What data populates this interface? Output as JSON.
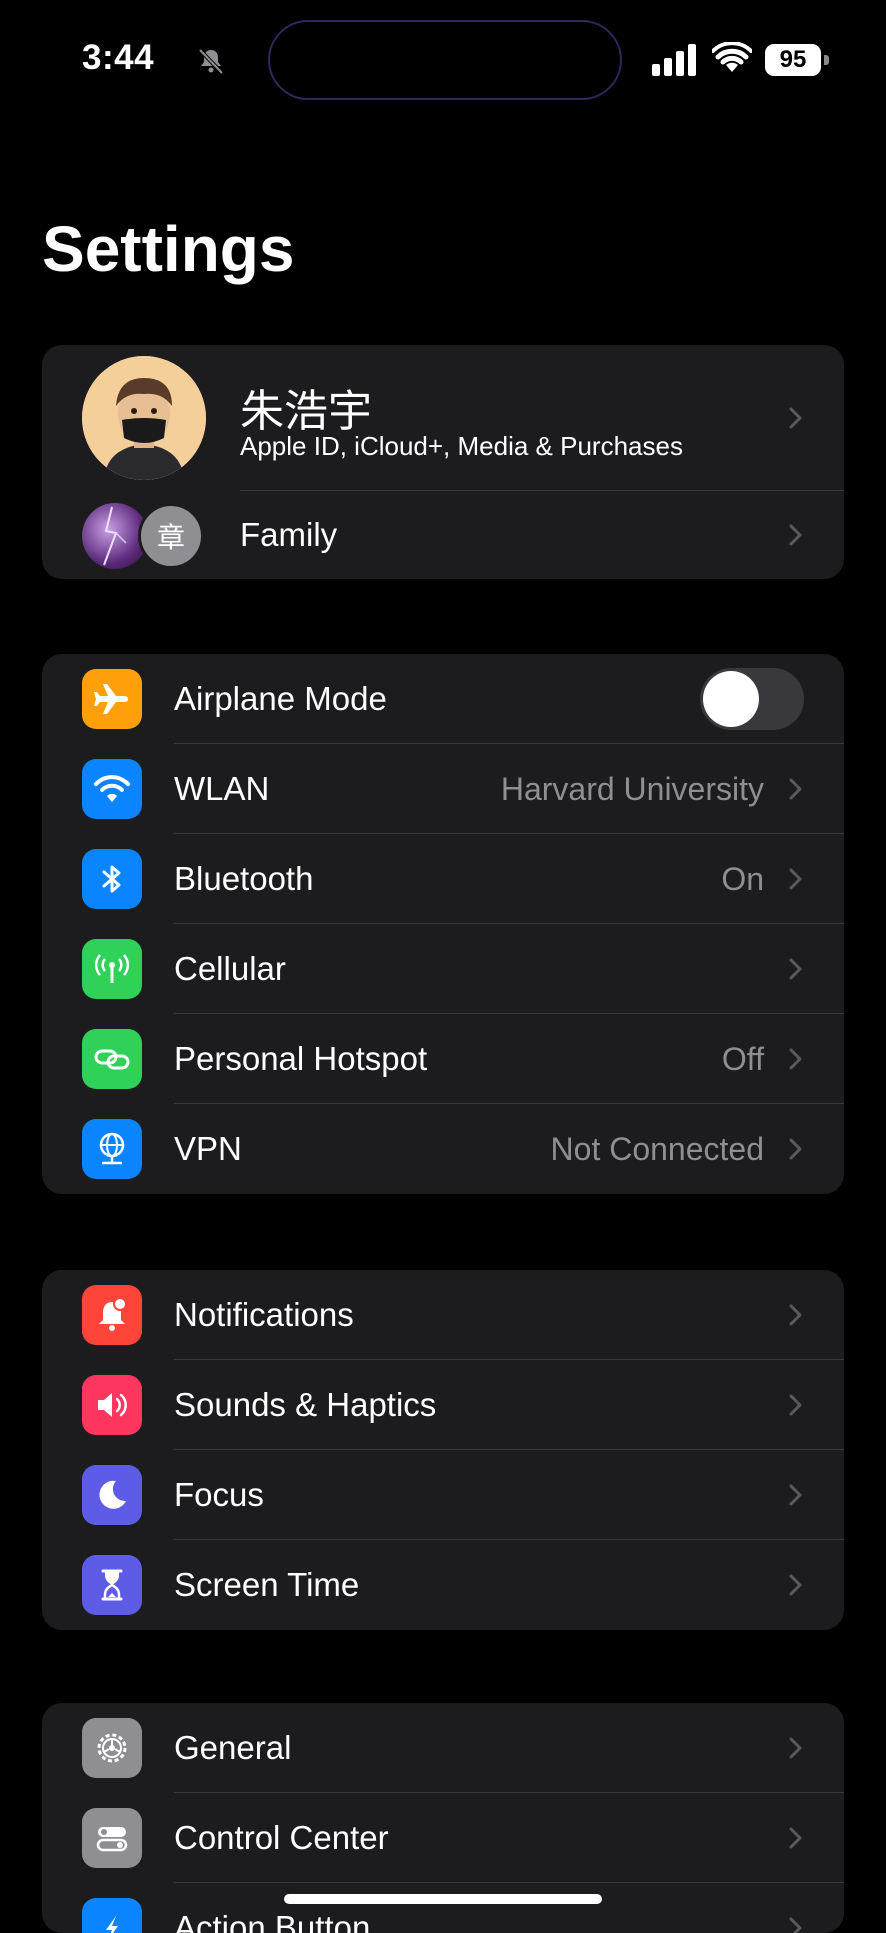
{
  "status_bar": {
    "time": "3:44",
    "battery": "95",
    "icons": [
      "bell-slash-icon",
      "cellular-signal-icon",
      "wifi-icon",
      "battery-icon"
    ]
  },
  "page": {
    "title": "Settings"
  },
  "profile": {
    "name": "朱浩宇",
    "subtitle": "Apple ID, iCloud+, Media & Purchases",
    "family_label": "Family",
    "family_member_initial": "章"
  },
  "connectivity": {
    "airplane": {
      "label": "Airplane Mode",
      "icon": "airplane-icon",
      "color": "#ff9f0a",
      "on": false
    },
    "wlan": {
      "label": "WLAN",
      "value": "Harvard University",
      "icon": "wifi-icon",
      "color": "#0a84ff"
    },
    "bluetooth": {
      "label": "Bluetooth",
      "value": "On",
      "icon": "bluetooth-icon",
      "color": "#0a84ff"
    },
    "cellular": {
      "label": "Cellular",
      "icon": "antenna-icon",
      "color": "#30d158"
    },
    "hotspot": {
      "label": "Personal Hotspot",
      "value": "Off",
      "icon": "link-icon",
      "color": "#30d158"
    },
    "vpn": {
      "label": "VPN",
      "value": "Not Connected",
      "icon": "globe-icon",
      "color": "#0a84ff"
    }
  },
  "attention": {
    "notifications": {
      "label": "Notifications",
      "icon": "bell-icon",
      "color": "#ff453a"
    },
    "sounds": {
      "label": "Sounds & Haptics",
      "icon": "speaker-icon",
      "color": "#ff375f"
    },
    "focus": {
      "label": "Focus",
      "icon": "moon-icon",
      "color": "#5e5ce6"
    },
    "screen_time": {
      "label": "Screen Time",
      "icon": "hourglass-icon",
      "color": "#5e5ce6"
    }
  },
  "system": {
    "general": {
      "label": "General",
      "icon": "gear-icon",
      "color": "#8e8e93"
    },
    "control_center": {
      "label": "Control Center",
      "icon": "toggles-icon",
      "color": "#8e8e93"
    },
    "action_button": {
      "label": "Action Button",
      "icon": "action-button-icon",
      "color": "#0a84ff"
    }
  }
}
